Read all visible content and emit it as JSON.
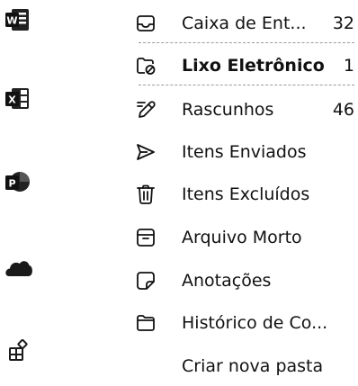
{
  "apps": [
    {
      "name": "word",
      "letter": "W",
      "color": "#1f5fb8"
    },
    {
      "name": "excel",
      "letter": "X",
      "color": "#1e7a44"
    },
    {
      "name": "powerpoint",
      "letter": "P",
      "color": "#c4462a"
    },
    {
      "name": "onedrive",
      "letter": "",
      "color": "#1c1c1c"
    },
    {
      "name": "more-apps",
      "letter": "",
      "color": "#1c1c1c"
    }
  ],
  "folders": [
    {
      "label": "Caixa de Ent...",
      "count": "32",
      "icon": "inbox-icon"
    },
    {
      "label": "Lixo Eletrônico",
      "count": "1",
      "icon": "junk-icon",
      "selected": true
    },
    {
      "label": "Rascunhos",
      "count": "46",
      "icon": "drafts-icon"
    },
    {
      "label": "Itens Enviados",
      "count": "",
      "icon": "sent-icon"
    },
    {
      "label": "Itens Excluídos",
      "count": "",
      "icon": "deleted-icon"
    },
    {
      "label": "Arquivo Morto",
      "count": "",
      "icon": "archive-icon"
    },
    {
      "label": "Anotações",
      "count": "",
      "icon": "notes-icon"
    },
    {
      "label": "Histórico de Co...",
      "count": "",
      "icon": "history-folder-icon"
    },
    {
      "label": "Criar nova pasta",
      "count": "",
      "icon": ""
    }
  ]
}
